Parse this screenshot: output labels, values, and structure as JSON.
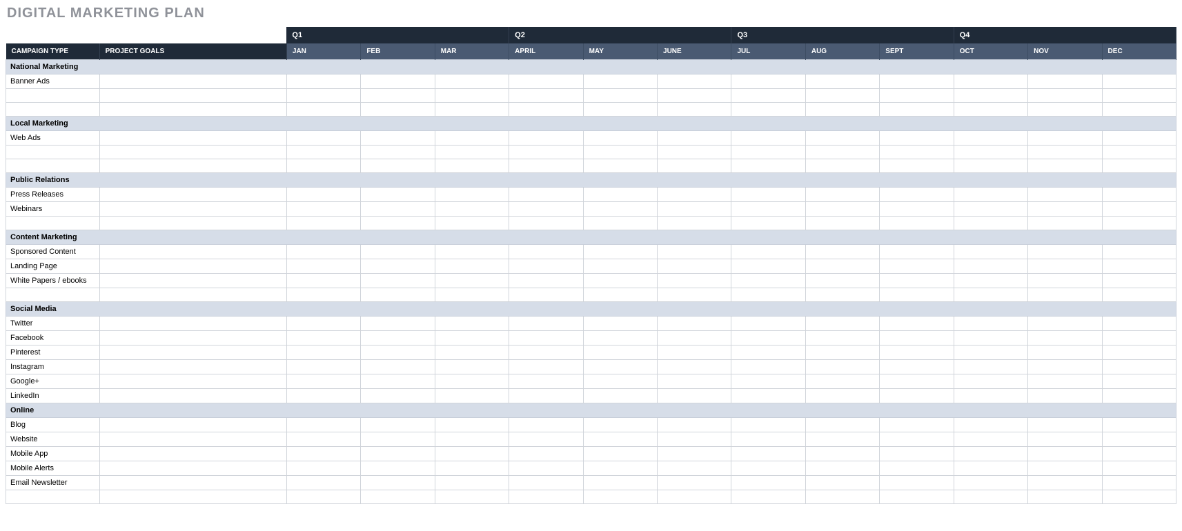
{
  "title": "DIGITAL MARKETING PLAN",
  "quarters": [
    "Q1",
    "Q2",
    "Q3",
    "Q4"
  ],
  "months": [
    "JAN",
    "FEB",
    "MAR",
    "APRIL",
    "MAY",
    "JUNE",
    "JUL",
    "AUG",
    "SEPT",
    "OCT",
    "NOV",
    "DEC"
  ],
  "headers": {
    "campaign": "CAMPAIGN TYPE",
    "goals": "PROJECT GOALS"
  },
  "sections": [
    {
      "name": "National Marketing",
      "rows": [
        "Banner Ads",
        "",
        ""
      ]
    },
    {
      "name": "Local Marketing",
      "rows": [
        "Web Ads",
        "",
        ""
      ]
    },
    {
      "name": "Public Relations",
      "rows": [
        "Press Releases",
        "Webinars",
        ""
      ]
    },
    {
      "name": "Content Marketing",
      "rows": [
        "Sponsored Content",
        "Landing Page",
        "White Papers / ebooks",
        ""
      ]
    },
    {
      "name": "Social Media",
      "rows": [
        "Twitter",
        "Facebook",
        "Pinterest",
        "Instagram",
        "Google+",
        "LinkedIn"
      ]
    },
    {
      "name": "Online",
      "rows": [
        "Blog",
        "Website",
        "Mobile App",
        "Mobile Alerts",
        "Email Newsletter",
        ""
      ]
    }
  ]
}
